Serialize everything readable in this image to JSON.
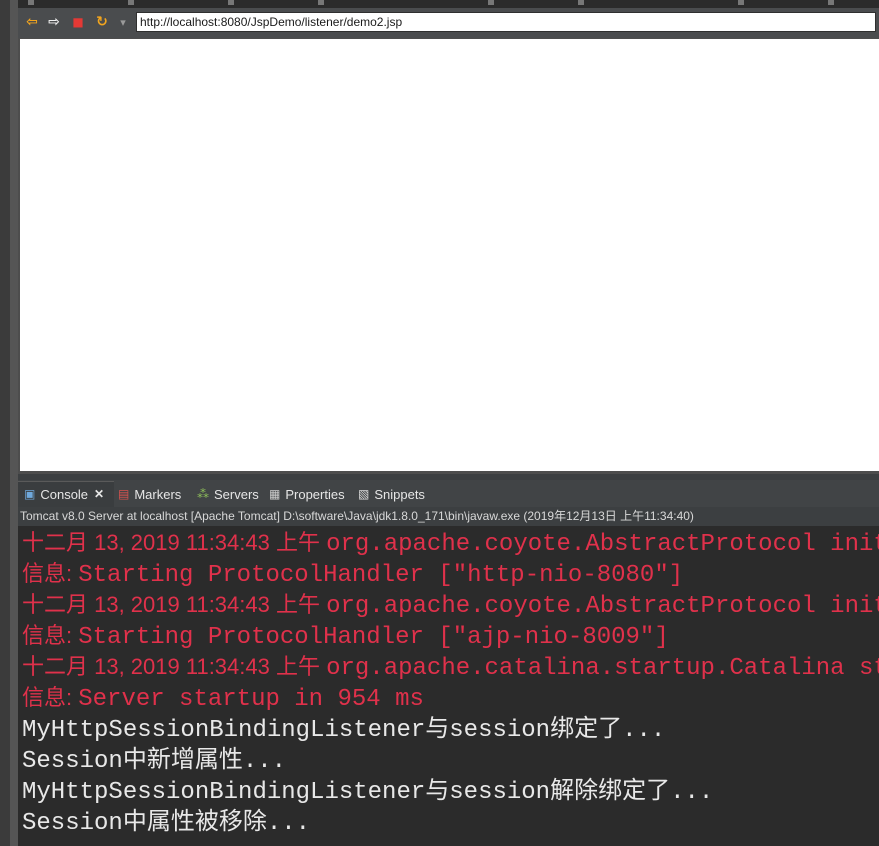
{
  "browser": {
    "url": "http://localhost:8080/JspDemo/listener/demo2.jsp",
    "buttons": {
      "back": "⇦",
      "forward": "⇨",
      "stop": "■",
      "refresh": "↻",
      "menu": "▾"
    }
  },
  "panel": {
    "tabs": [
      {
        "label": "Console",
        "icon": "console-icon"
      },
      {
        "label": "Markers",
        "icon": "markers-icon"
      },
      {
        "label": "Servers",
        "icon": "servers-icon"
      },
      {
        "label": "Properties",
        "icon": "properties-icon"
      },
      {
        "label": "Snippets",
        "icon": "snippets-icon"
      }
    ],
    "close_glyph": "✕"
  },
  "console": {
    "info": "Tomcat v8.0 Server at localhost [Apache Tomcat] D:\\software\\Java\\jdk1.8.0_171\\bin\\javaw.exe (2019年12月13日 上午11:34:40)",
    "lines": [
      {
        "color": "red",
        "prefix": "十二月 13, 2019 11:34:43 上午 ",
        "text": "org.apache.coyote.AbstractProtocol init"
      },
      {
        "color": "red",
        "prefix": "信息: ",
        "text": "Starting ProtocolHandler [\"http-nio-8080\"]"
      },
      {
        "color": "red",
        "prefix": "十二月 13, 2019 11:34:43 上午 ",
        "text": "org.apache.coyote.AbstractProtocol init"
      },
      {
        "color": "red",
        "prefix": "信息: ",
        "text": "Starting ProtocolHandler [\"ajp-nio-8009\"]"
      },
      {
        "color": "red",
        "prefix": "十二月 13, 2019 11:34:43 上午 ",
        "text": "org.apache.catalina.startup.Catalina start"
      },
      {
        "color": "red",
        "prefix": "信息: ",
        "text": "Server startup in 954 ms"
      },
      {
        "color": "white",
        "prefix": "",
        "text": "MyHttpSessionBindingListener与session绑定了..."
      },
      {
        "color": "white",
        "prefix": "",
        "text": "Session中新增属性..."
      },
      {
        "color": "white",
        "prefix": "",
        "text": "MyHttpSessionBindingListener与session解除绑定了..."
      },
      {
        "color": "white",
        "prefix": "",
        "text": "Session中属性被移除..."
      }
    ]
  },
  "colors": {
    "console_error": "#e0314b",
    "console_output": "#e8e8e8",
    "console_bg": "#2b2b2b"
  }
}
